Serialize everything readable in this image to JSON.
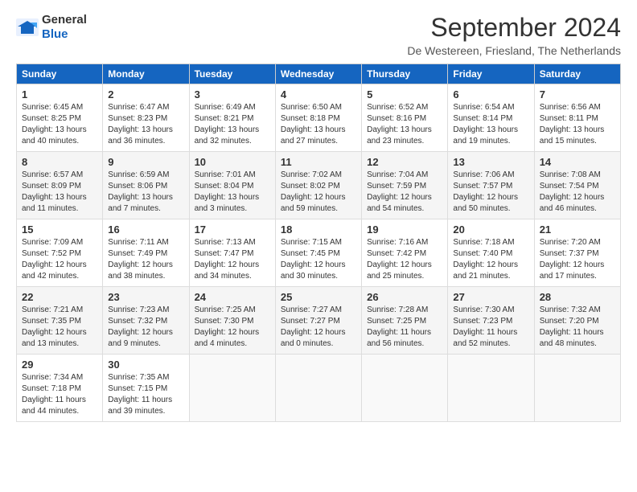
{
  "logo": {
    "general": "General",
    "blue": "Blue"
  },
  "title": "September 2024",
  "location": "De Westereen, Friesland, The Netherlands",
  "headers": [
    "Sunday",
    "Monday",
    "Tuesday",
    "Wednesday",
    "Thursday",
    "Friday",
    "Saturday"
  ],
  "weeks": [
    [
      {
        "day": "1",
        "info": "Sunrise: 6:45 AM\nSunset: 8:25 PM\nDaylight: 13 hours\nand 40 minutes."
      },
      {
        "day": "2",
        "info": "Sunrise: 6:47 AM\nSunset: 8:23 PM\nDaylight: 13 hours\nand 36 minutes."
      },
      {
        "day": "3",
        "info": "Sunrise: 6:49 AM\nSunset: 8:21 PM\nDaylight: 13 hours\nand 32 minutes."
      },
      {
        "day": "4",
        "info": "Sunrise: 6:50 AM\nSunset: 8:18 PM\nDaylight: 13 hours\nand 27 minutes."
      },
      {
        "day": "5",
        "info": "Sunrise: 6:52 AM\nSunset: 8:16 PM\nDaylight: 13 hours\nand 23 minutes."
      },
      {
        "day": "6",
        "info": "Sunrise: 6:54 AM\nSunset: 8:14 PM\nDaylight: 13 hours\nand 19 minutes."
      },
      {
        "day": "7",
        "info": "Sunrise: 6:56 AM\nSunset: 8:11 PM\nDaylight: 13 hours\nand 15 minutes."
      }
    ],
    [
      {
        "day": "8",
        "info": "Sunrise: 6:57 AM\nSunset: 8:09 PM\nDaylight: 13 hours\nand 11 minutes."
      },
      {
        "day": "9",
        "info": "Sunrise: 6:59 AM\nSunset: 8:06 PM\nDaylight: 13 hours\nand 7 minutes."
      },
      {
        "day": "10",
        "info": "Sunrise: 7:01 AM\nSunset: 8:04 PM\nDaylight: 13 hours\nand 3 minutes."
      },
      {
        "day": "11",
        "info": "Sunrise: 7:02 AM\nSunset: 8:02 PM\nDaylight: 12 hours\nand 59 minutes."
      },
      {
        "day": "12",
        "info": "Sunrise: 7:04 AM\nSunset: 7:59 PM\nDaylight: 12 hours\nand 54 minutes."
      },
      {
        "day": "13",
        "info": "Sunrise: 7:06 AM\nSunset: 7:57 PM\nDaylight: 12 hours\nand 50 minutes."
      },
      {
        "day": "14",
        "info": "Sunrise: 7:08 AM\nSunset: 7:54 PM\nDaylight: 12 hours\nand 46 minutes."
      }
    ],
    [
      {
        "day": "15",
        "info": "Sunrise: 7:09 AM\nSunset: 7:52 PM\nDaylight: 12 hours\nand 42 minutes."
      },
      {
        "day": "16",
        "info": "Sunrise: 7:11 AM\nSunset: 7:49 PM\nDaylight: 12 hours\nand 38 minutes."
      },
      {
        "day": "17",
        "info": "Sunrise: 7:13 AM\nSunset: 7:47 PM\nDaylight: 12 hours\nand 34 minutes."
      },
      {
        "day": "18",
        "info": "Sunrise: 7:15 AM\nSunset: 7:45 PM\nDaylight: 12 hours\nand 30 minutes."
      },
      {
        "day": "19",
        "info": "Sunrise: 7:16 AM\nSunset: 7:42 PM\nDaylight: 12 hours\nand 25 minutes."
      },
      {
        "day": "20",
        "info": "Sunrise: 7:18 AM\nSunset: 7:40 PM\nDaylight: 12 hours\nand 21 minutes."
      },
      {
        "day": "21",
        "info": "Sunrise: 7:20 AM\nSunset: 7:37 PM\nDaylight: 12 hours\nand 17 minutes."
      }
    ],
    [
      {
        "day": "22",
        "info": "Sunrise: 7:21 AM\nSunset: 7:35 PM\nDaylight: 12 hours\nand 13 minutes."
      },
      {
        "day": "23",
        "info": "Sunrise: 7:23 AM\nSunset: 7:32 PM\nDaylight: 12 hours\nand 9 minutes."
      },
      {
        "day": "24",
        "info": "Sunrise: 7:25 AM\nSunset: 7:30 PM\nDaylight: 12 hours\nand 4 minutes."
      },
      {
        "day": "25",
        "info": "Sunrise: 7:27 AM\nSunset: 7:27 PM\nDaylight: 12 hours\nand 0 minutes."
      },
      {
        "day": "26",
        "info": "Sunrise: 7:28 AM\nSunset: 7:25 PM\nDaylight: 11 hours\nand 56 minutes."
      },
      {
        "day": "27",
        "info": "Sunrise: 7:30 AM\nSunset: 7:23 PM\nDaylight: 11 hours\nand 52 minutes."
      },
      {
        "day": "28",
        "info": "Sunrise: 7:32 AM\nSunset: 7:20 PM\nDaylight: 11 hours\nand 48 minutes."
      }
    ],
    [
      {
        "day": "29",
        "info": "Sunrise: 7:34 AM\nSunset: 7:18 PM\nDaylight: 11 hours\nand 44 minutes."
      },
      {
        "day": "30",
        "info": "Sunrise: 7:35 AM\nSunset: 7:15 PM\nDaylight: 11 hours\nand 39 minutes."
      },
      {
        "day": "",
        "info": ""
      },
      {
        "day": "",
        "info": ""
      },
      {
        "day": "",
        "info": ""
      },
      {
        "day": "",
        "info": ""
      },
      {
        "day": "",
        "info": ""
      }
    ]
  ]
}
